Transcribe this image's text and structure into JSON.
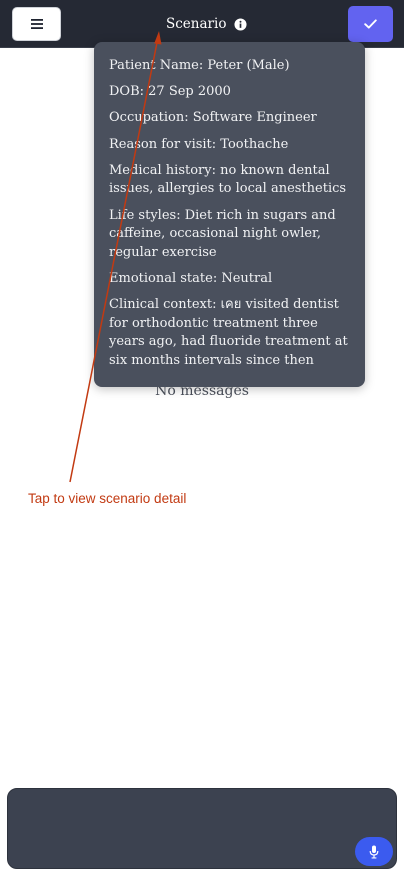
{
  "header": {
    "menu_icon": "hamburger-icon",
    "title": "Scenario",
    "info_icon": "info-circle-icon",
    "confirm_icon": "checkmark-icon",
    "accent_color": "#6263f0"
  },
  "scenario": {
    "patient_name": "Patient Name: Peter (Male)",
    "dob": "DOB: 27 Sep 2000",
    "occupation": "Occupation: Software Engineer",
    "reason": "Reason for visit: Toothache",
    "medical_history": "Medical history: no known dental issues, allergies to local anesthetics",
    "life_styles": "Life styles: Diet rich in sugars and caffeine, occasional night owler, regular exercise",
    "emotional_state": "Emotional state: Neutral",
    "clinical_context": "Clinical context: เคย visited dentist for orthodontic treatment three years ago, had fluoride treatment at six months intervals since then"
  },
  "chat": {
    "empty_text": "No messages"
  },
  "annotation": {
    "label": "Tap to view scenario detail",
    "color": "#c23a12"
  },
  "composer": {
    "value": "",
    "mic_icon": "microphone-icon",
    "mic_color": "#3b5bef"
  }
}
